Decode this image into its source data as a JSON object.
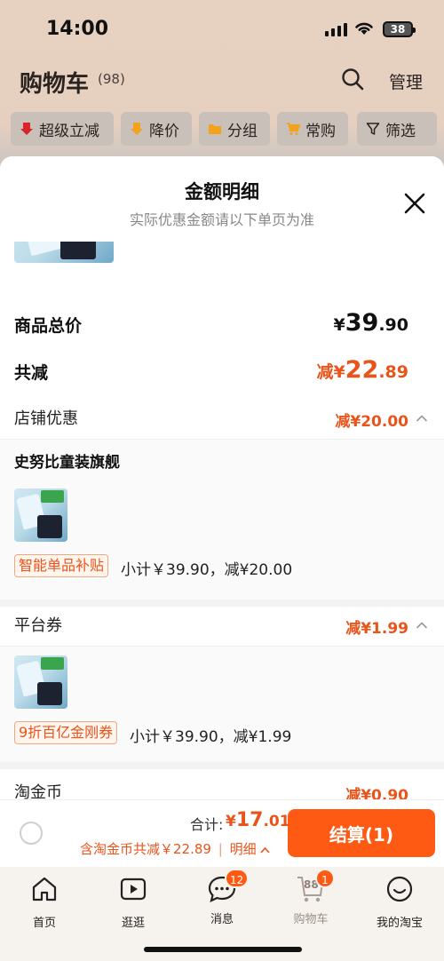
{
  "status_bar": {
    "time": "14:00",
    "battery": "38"
  },
  "header": {
    "title": "购物车",
    "count": "(98)",
    "manage_label": "管理"
  },
  "filters": [
    {
      "label": "超级立减",
      "icon": "arrow-down-red-icon"
    },
    {
      "label": "降价",
      "icon": "arrow-down-yellow-icon"
    },
    {
      "label": "分组",
      "icon": "folder-icon"
    },
    {
      "label": "常购",
      "icon": "cart-icon"
    },
    {
      "label": "筛选",
      "icon": "filter-icon"
    }
  ],
  "sheet": {
    "title": "金额明细",
    "subtitle": "实际优惠金额请以下单页为准",
    "total_price": {
      "label": "商品总价",
      "currency": "¥",
      "integer": "39",
      "decimal": ".90"
    },
    "total_discount": {
      "label": "共减",
      "prefix": "减¥",
      "integer": "22",
      "decimal": ".89"
    },
    "store_discount": {
      "label": "店铺优惠",
      "amount": "减¥20.00",
      "shop_name": "史努比童装旗舰",
      "badge": "智能单品补贴",
      "subtotal": "小计￥39.90，减¥20.00"
    },
    "platform_coupon": {
      "label": "平台券",
      "amount": "减¥1.99",
      "badge": "9折百亿金刚券",
      "subtotal": "小计￥39.90，减¥1.99"
    },
    "taojinbi": {
      "label": "淘金币",
      "amount": "减¥0.90"
    }
  },
  "checkout": {
    "total_label": "合计:",
    "total_currency": "¥",
    "total_integer": "17",
    "total_decimal": ".01",
    "deduct_text": "含淘金币共减￥22.89",
    "detail_link": "明细",
    "pay_label": "结算(1)"
  },
  "tabbar": [
    {
      "label": "首页",
      "icon": "home-icon"
    },
    {
      "label": "逛逛",
      "icon": "video-icon"
    },
    {
      "label": "消息",
      "icon": "message-icon",
      "badge": "12"
    },
    {
      "label": "购物车",
      "icon": "cart-icon",
      "cart_count": "88",
      "badge": "1"
    },
    {
      "label": "我的淘宝",
      "icon": "smile-icon"
    }
  ],
  "colors": {
    "accent": "#ff5a14",
    "discount": "#e8541a"
  }
}
